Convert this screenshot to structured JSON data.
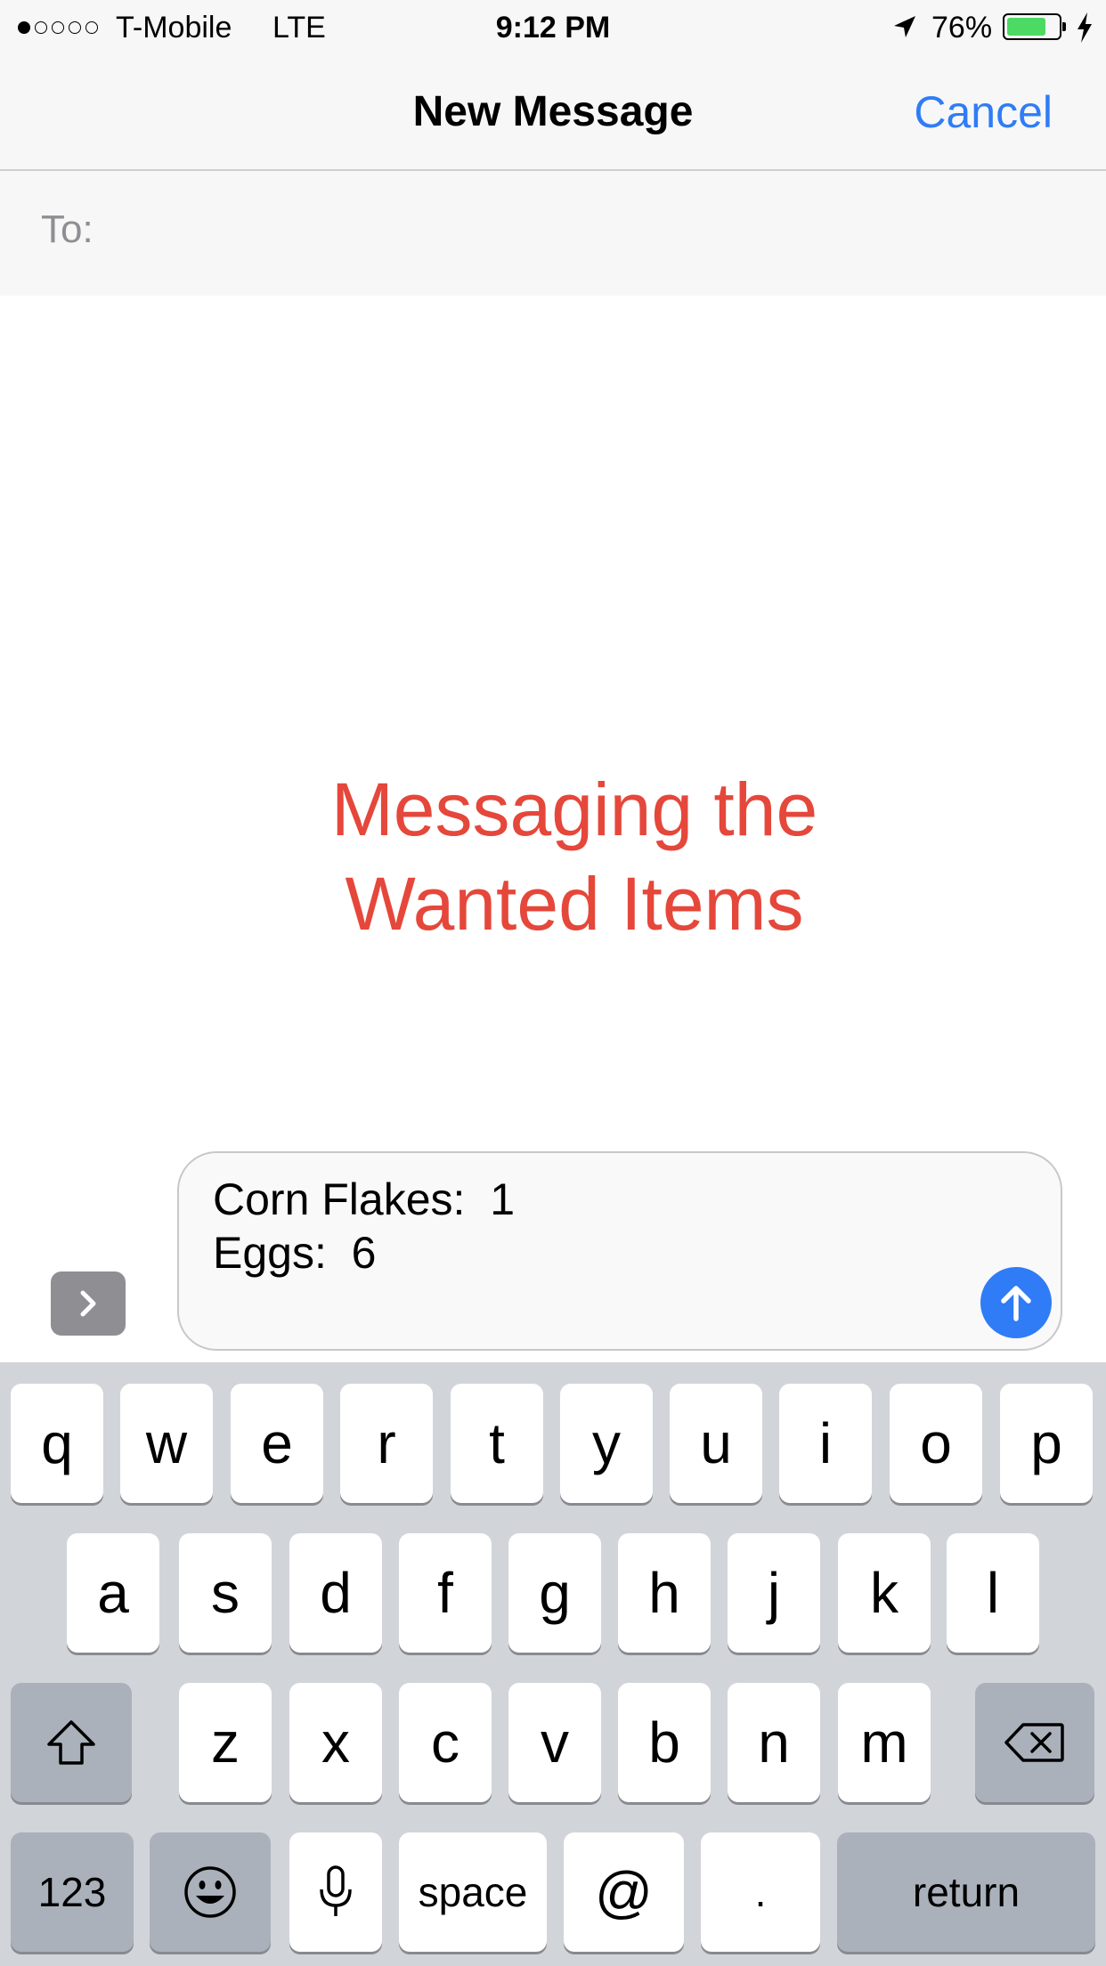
{
  "status_bar": {
    "carrier": "T-Mobile",
    "network": "LTE",
    "time": "9:12 PM",
    "battery_percent": "76%",
    "battery_level": 0.76,
    "signal_strength_dots": 1
  },
  "nav": {
    "title": "New Message",
    "cancel_label": "Cancel"
  },
  "to_field": {
    "label": "To:",
    "value": ""
  },
  "caption": {
    "line1": "Messaging the",
    "line2": "Wanted Items"
  },
  "compose": {
    "message_text": "Corn Flakes:  1\nEggs:  6"
  },
  "keyboard": {
    "row1": [
      "q",
      "w",
      "e",
      "r",
      "t",
      "y",
      "u",
      "i",
      "o",
      "p"
    ],
    "row2": [
      "a",
      "s",
      "d",
      "f",
      "g",
      "h",
      "j",
      "k",
      "l"
    ],
    "row3": [
      "z",
      "x",
      "c",
      "v",
      "b",
      "n",
      "m"
    ],
    "numbers_label": "123",
    "space_label": "space",
    "at_label": "@",
    "period_label": ".",
    "return_label": "return"
  },
  "colors": {
    "accent": "#2f7cf6",
    "caption": "#e5473b",
    "battery": "#4cd964"
  }
}
